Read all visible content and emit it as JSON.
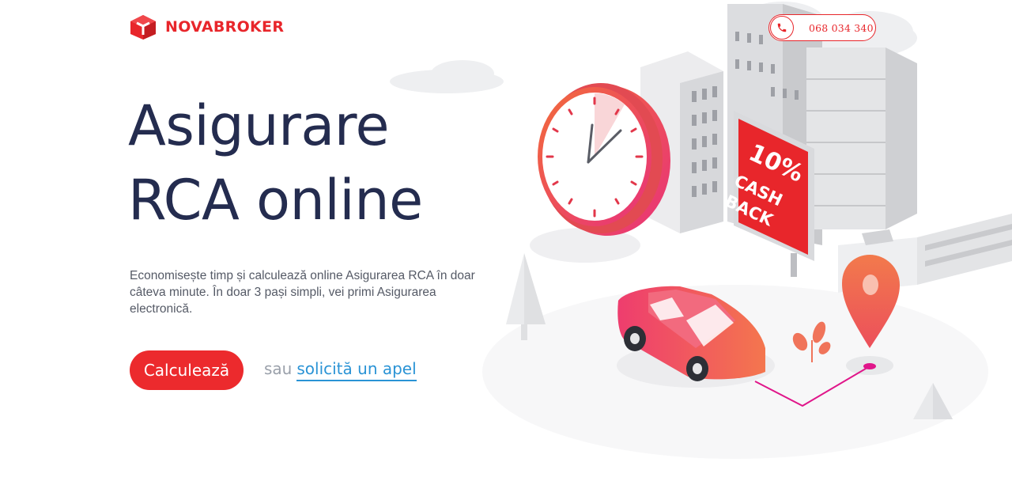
{
  "brand": {
    "name": "NOVABROKER",
    "color": "#e8262b"
  },
  "header": {
    "phone": "068 034 340",
    "phone_icon": "phone-icon"
  },
  "hero": {
    "title_line1": "Asigurare",
    "title_line2": "RCA online",
    "description": "Economisește timp și calculează online Asigurarea RCA în doar câteva minute. În doar 3 pași simpli, vei primi Asigurarea electronică.",
    "cta_label": "Calculează",
    "alt_prefix": "sau",
    "alt_link": "solicită un apel"
  },
  "illustration": {
    "cashback_line1": "10%",
    "cashback_line2": "CASH",
    "cashback_line3": "BACK"
  },
  "colors": {
    "accent": "#ec2a2d",
    "heading": "#242c4f",
    "link": "#2a93d5"
  }
}
